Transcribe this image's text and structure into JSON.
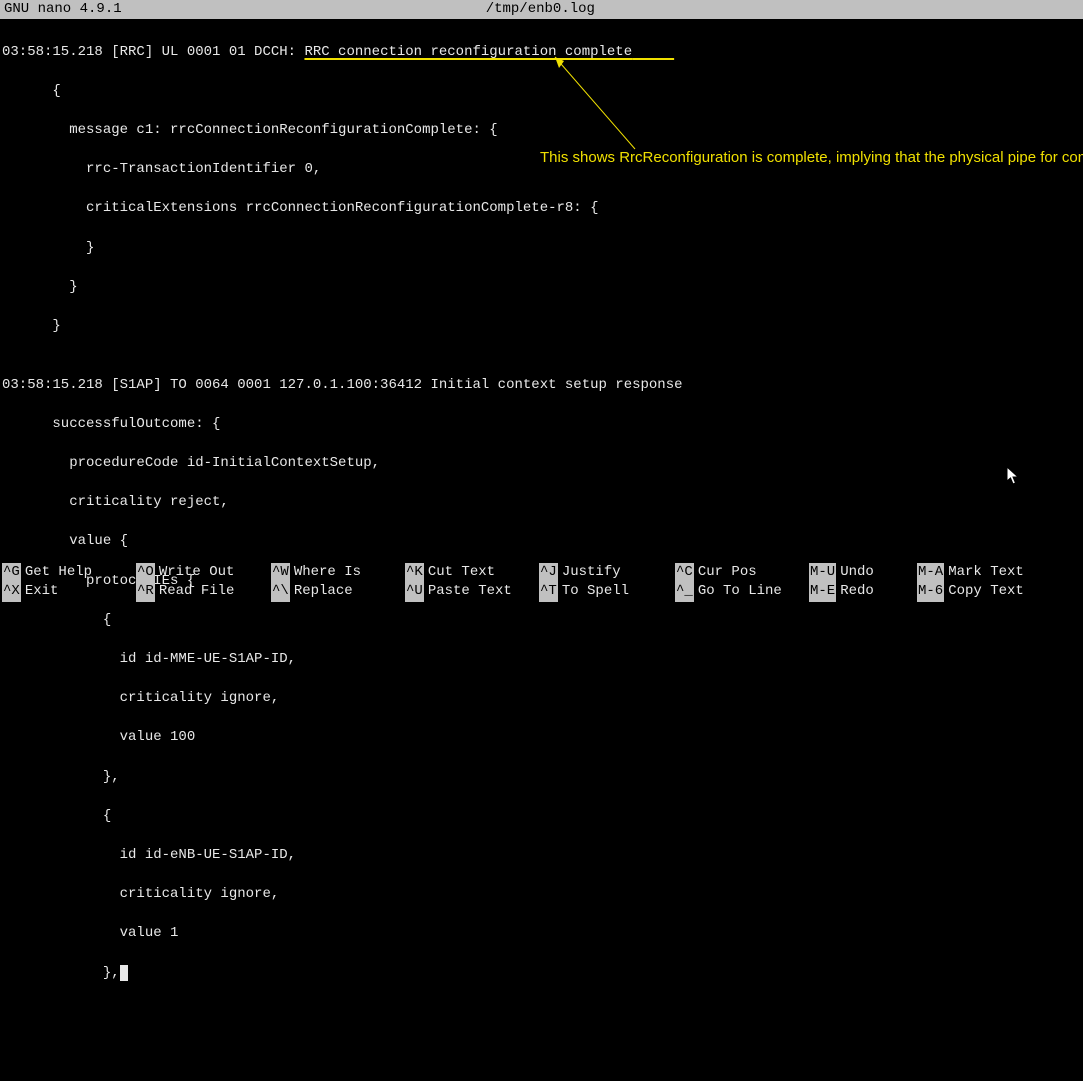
{
  "titlebar": {
    "app": "GNU nano 4.9.1",
    "filename": "/tmp/enb0.log"
  },
  "log": {
    "line1_prefix": "03:58:15.218 [RRC] UL 0001 01 DCCH: ",
    "line1_underlined": "RRC connection reconfiguration complete",
    "block1_l1": "      {",
    "block1_l2": "        message c1: rrcConnectionReconfigurationComplete: {",
    "block1_l3": "          rrc-TransactionIdentifier 0,",
    "block1_l4": "          criticalExtensions rrcConnectionReconfigurationComplete-r8: {",
    "block1_l5": "          }",
    "block1_l6": "        }",
    "block1_l7": "      }",
    "blank": "",
    "line2": "03:58:15.218 [S1AP] TO 0064 0001 127.0.1.100:36412 Initial context setup response",
    "block2_l1": "      successfulOutcome: {",
    "block2_l2": "        procedureCode id-InitialContextSetup,",
    "block2_l3": "        criticality reject,",
    "block2_l4": "        value {",
    "block2_l5": "          protocolIEs {",
    "block2_l6": "            {",
    "block2_l7": "              id id-MME-UE-S1AP-ID,",
    "block2_l8": "              criticality ignore,",
    "block2_l9": "              value 100",
    "block2_l10": "            },",
    "block2_l11": "            {",
    "block2_l12": "              id id-eNB-UE-S1AP-ID,",
    "block2_l13": "              criticality ignore,",
    "block2_l14": "              value 1",
    "block2_l15": "            },"
  },
  "annotation": {
    "text": "This shows RrcReconfiguration is complete, implying that the physical pipe for communication is setup"
  },
  "shortcuts": {
    "row1": [
      {
        "key": "^G",
        "label": "Get Help",
        "w": 134
      },
      {
        "key": "^O",
        "label": "Write Out",
        "w": 135
      },
      {
        "key": "^W",
        "label": "Where Is",
        "w": 134
      },
      {
        "key": "^K",
        "label": "Cut Text",
        "w": 134
      },
      {
        "key": "^J",
        "label": "Justify",
        "w": 136
      },
      {
        "key": "^C",
        "label": "Cur Pos",
        "w": 134
      },
      {
        "key": "M-U",
        "label": "Undo",
        "w": 108
      },
      {
        "key": "M-A",
        "label": "Mark Text",
        "w": 120
      }
    ],
    "row2": [
      {
        "key": "^X",
        "label": "Exit",
        "w": 134
      },
      {
        "key": "^R",
        "label": "Read File",
        "w": 135
      },
      {
        "key": "^\\",
        "label": "Replace",
        "w": 134
      },
      {
        "key": "^U",
        "label": "Paste Text",
        "w": 134
      },
      {
        "key": "^T",
        "label": "To Spell",
        "w": 136
      },
      {
        "key": "^_",
        "label": "Go To Line",
        "w": 134
      },
      {
        "key": "M-E",
        "label": "Redo",
        "w": 108
      },
      {
        "key": "M-6",
        "label": "Copy Text",
        "w": 120
      }
    ]
  }
}
